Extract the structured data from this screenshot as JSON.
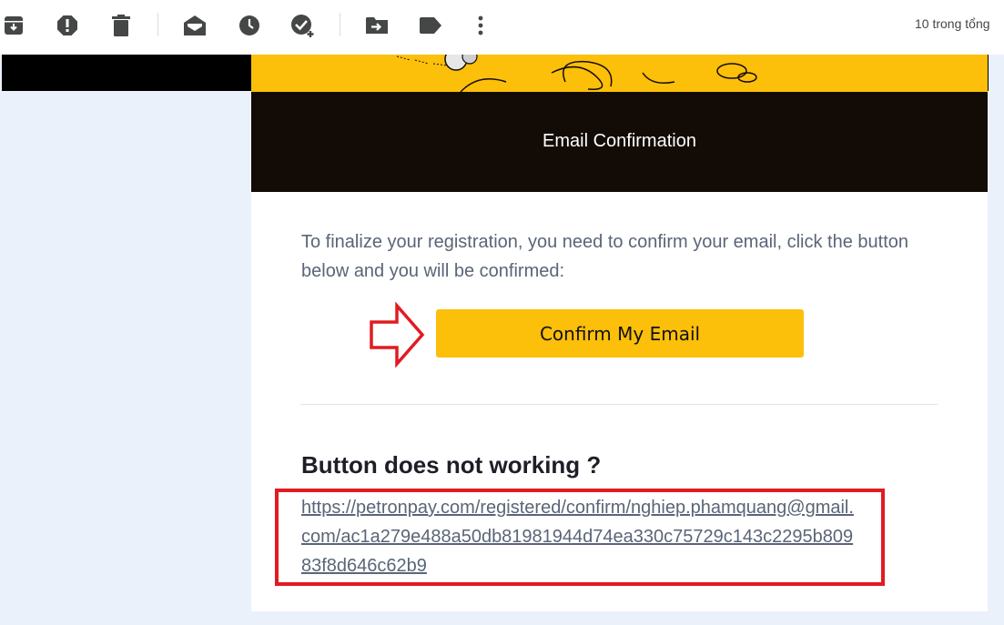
{
  "toolbar": {
    "icons": [
      "archive-icon",
      "report-spam-icon",
      "delete-icon",
      "mark-as-read-icon",
      "snooze-icon",
      "add-to-tasks-icon",
      "move-to-icon",
      "label-icon",
      "more-options-icon"
    ],
    "count_text": "10 trong tổng"
  },
  "email": {
    "banner_title": "Email Confirmation",
    "intro_text": "To finalize your registration, you need to confirm your email, click the button below and you will be confirmed:",
    "confirm_button_label": "Confirm My Email",
    "fallback_heading": "Button does not working ?",
    "fallback_link": "https://petronpay.com/registered/confirm/nghiep.phamquang@gmail.com/ac1a279e488a50db81981944d74ea330c75729c143c2295b80983f8d646c62b9"
  },
  "colors": {
    "brand_yellow": "#fcbf0a",
    "annotation_red": "#e11b22",
    "banner_dark": "#130c06"
  }
}
